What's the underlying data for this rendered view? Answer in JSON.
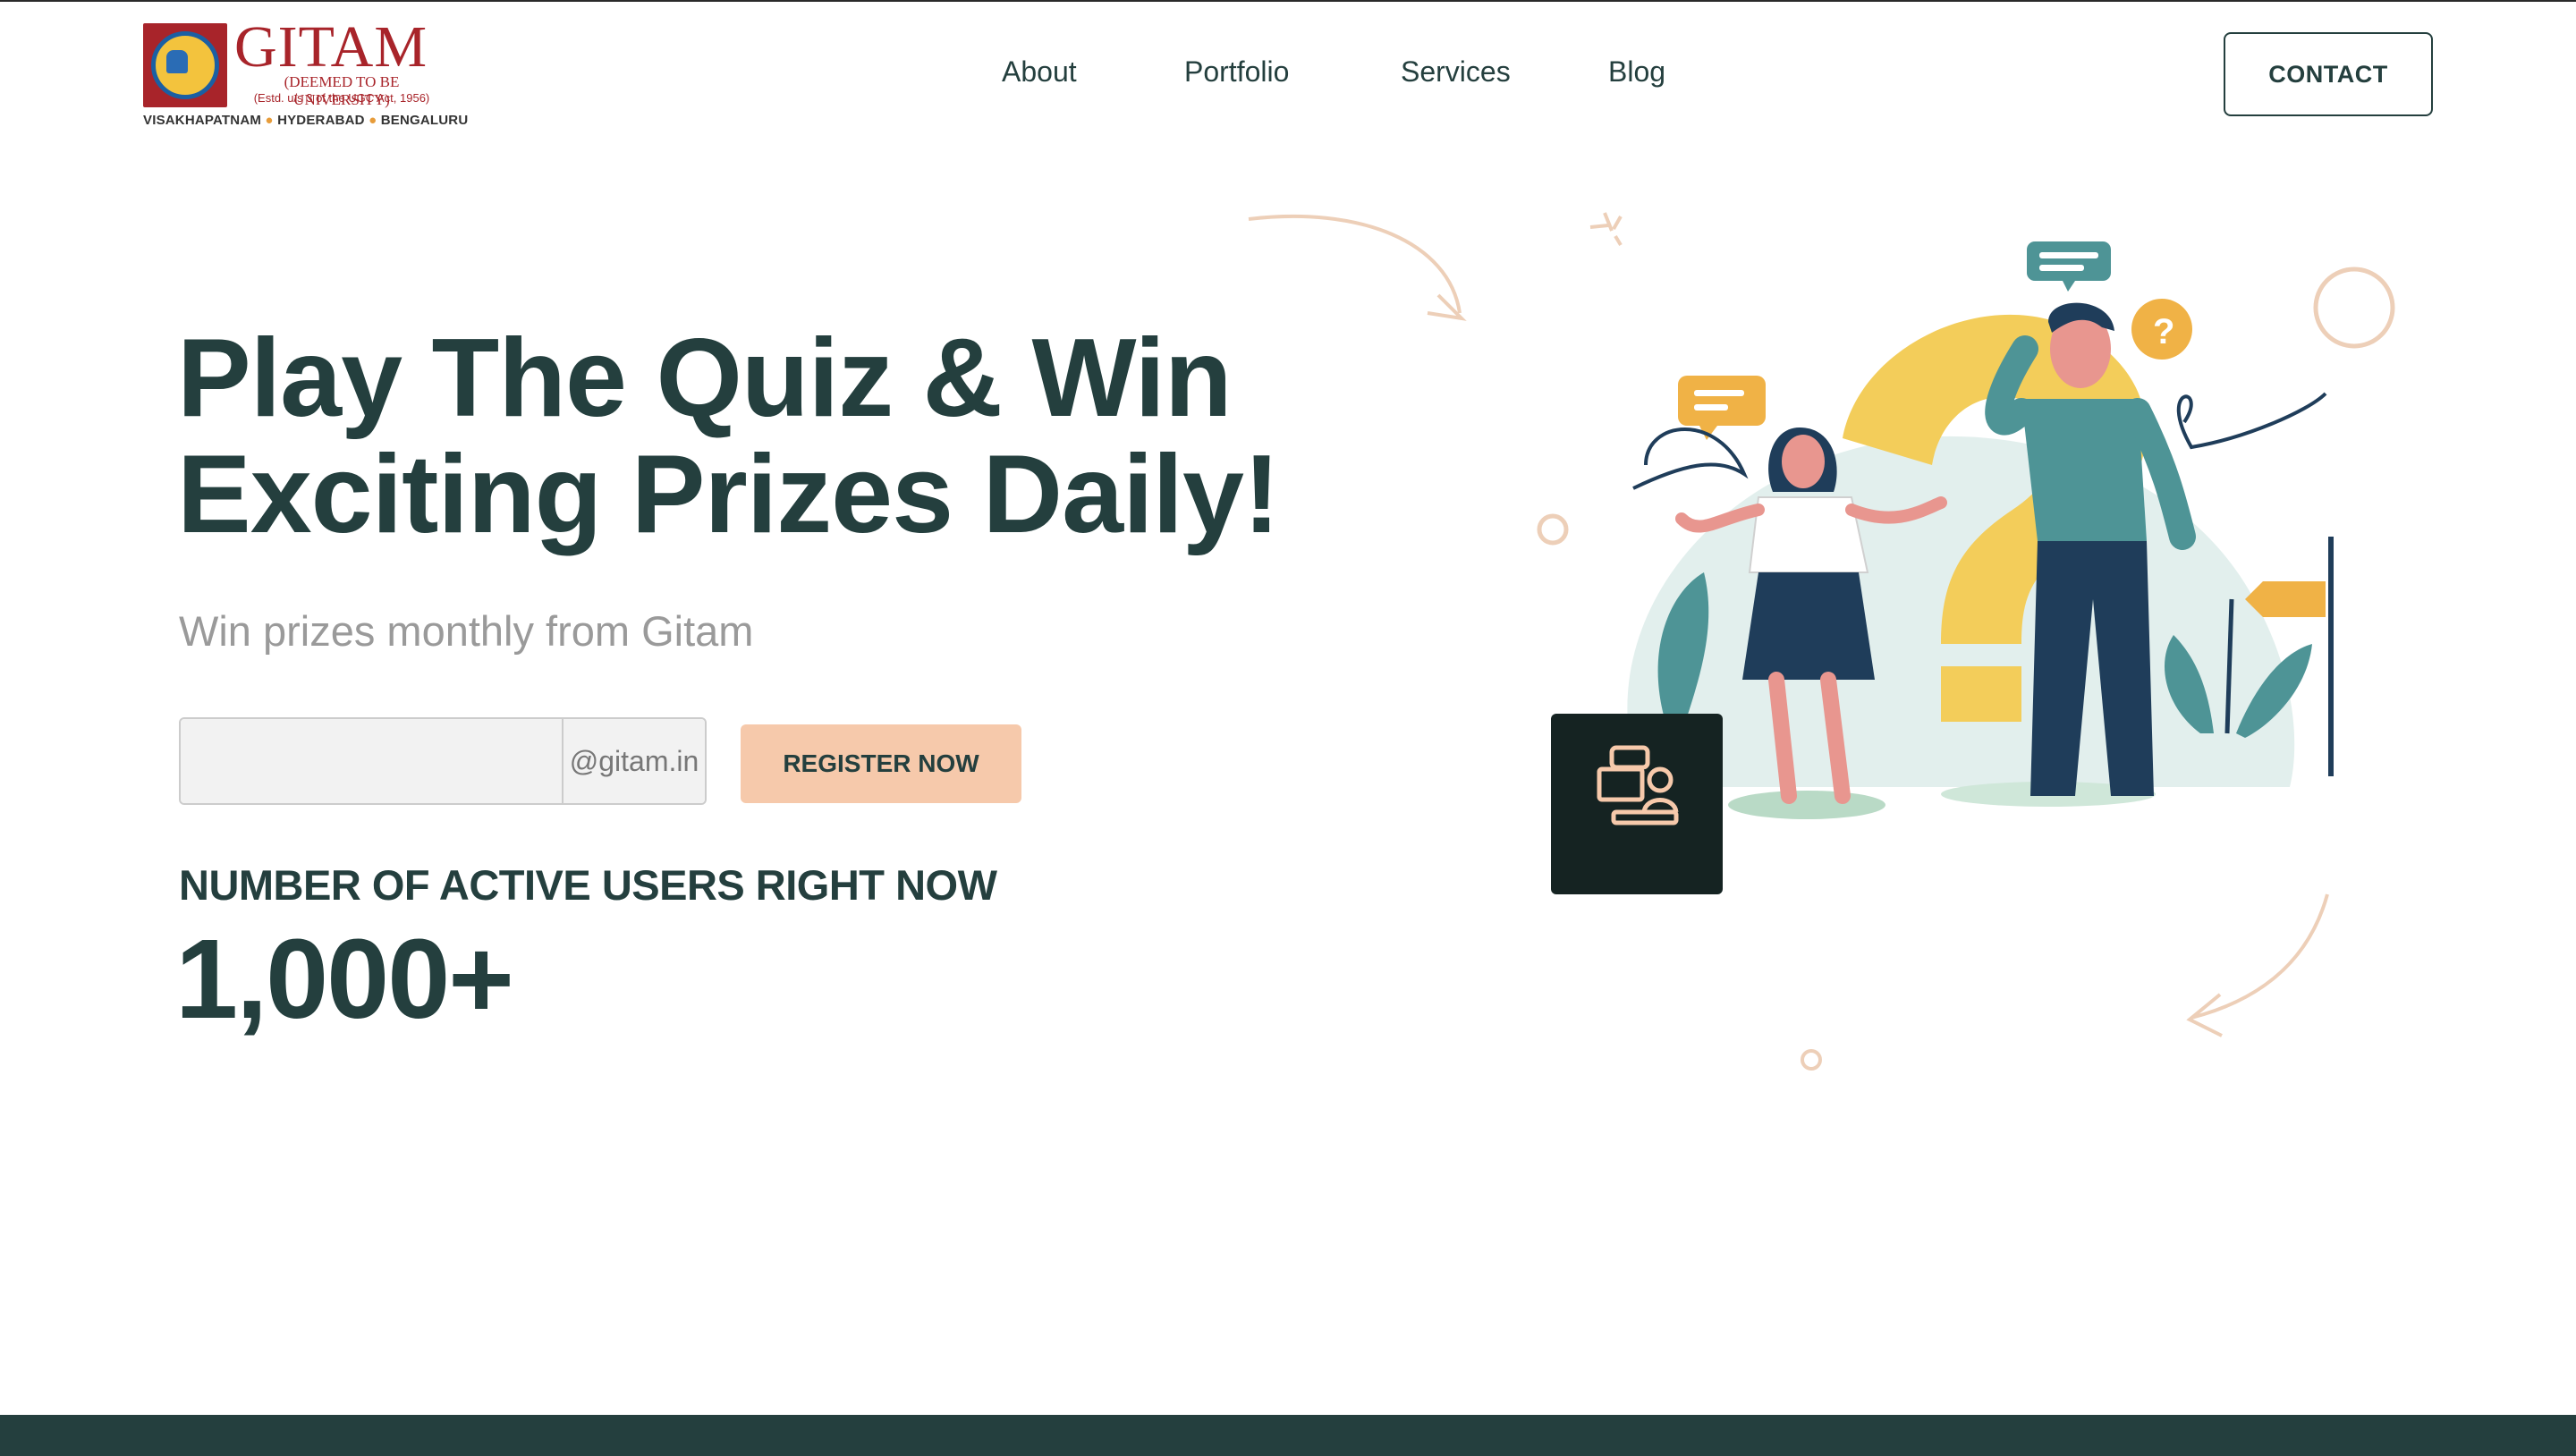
{
  "brand": {
    "name": "GITAM",
    "line1": "(DEEMED TO BE UNIVERSITY)",
    "line2": "(Estd. u/s 3 of the UGC Act, 1956)",
    "cities": [
      "VISAKHAPATNAM",
      "HYDERABAD",
      "BENGALURU"
    ],
    "primary_color": "#a8242a"
  },
  "nav": {
    "items": [
      {
        "label": "About"
      },
      {
        "label": "Portfolio"
      },
      {
        "label": "Services"
      },
      {
        "label": "Blog"
      }
    ],
    "contact_label": "CONTACT"
  },
  "hero": {
    "title_line1": "Play The Quiz & Win",
    "title_line2": "Exciting Prizes Daily!",
    "subtitle": "Win prizes monthly from Gitam",
    "email": {
      "value": "",
      "placeholder": "",
      "suffix": "@gitam.in"
    },
    "register_label": "REGISTER NOW",
    "stat_label": "NUMBER OF ACTIVE USERS RIGHT NOW",
    "stat_value": "1,000+"
  },
  "icons": {
    "live_chat_badge": "support-agent-icon",
    "speech_bubble_question": "question-bubble-icon"
  },
  "colors": {
    "text_primary": "#243f3e",
    "accent_button": "#f6c9ab",
    "subtitle_gray": "#9a9a9a",
    "footer_bar": "#243f3e",
    "illustration_yellow": "#f3cd5a",
    "illustration_teal": "#4e9496"
  }
}
